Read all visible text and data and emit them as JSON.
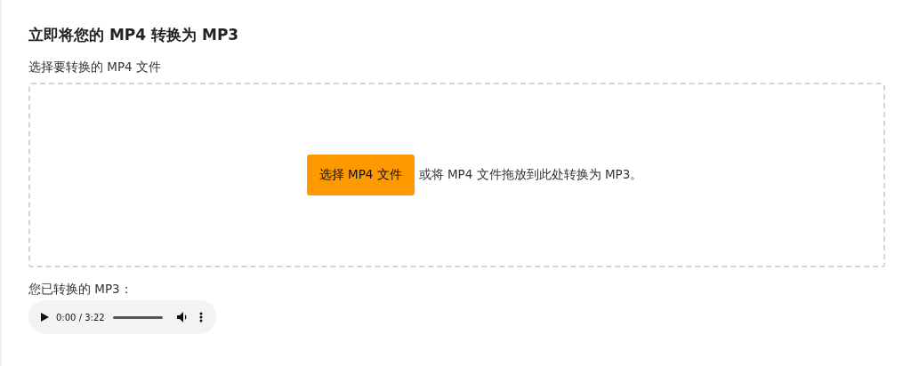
{
  "title": "立即将您的 MP4 转换为 MP3",
  "file_label": "选择要转换的 MP4 文件",
  "dropzone": {
    "button": "选择 MP4 文件",
    "hint": "或将 MP4 文件拖放到此处转换为 MP3。"
  },
  "output": {
    "label": "您已转换的 MP3：",
    "player": {
      "time": "0:00 / 3:22"
    }
  }
}
